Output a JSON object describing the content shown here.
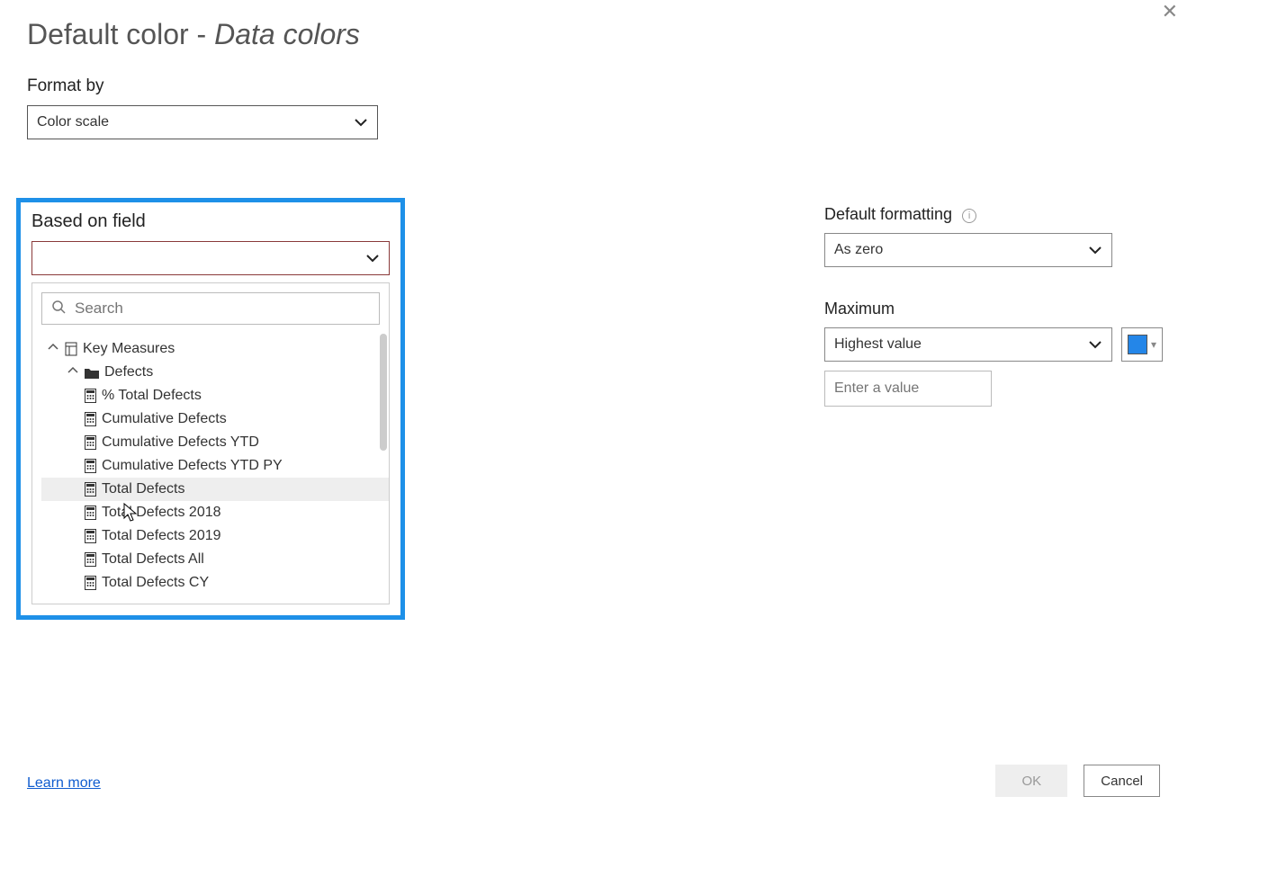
{
  "dialog": {
    "title_main": "Default color",
    "title_sep": " - ",
    "title_italic": "Data colors"
  },
  "format_by": {
    "label": "Format by",
    "value": "Color scale"
  },
  "based_on_field": {
    "label": "Based on field",
    "value": "",
    "search_placeholder": "Search",
    "tree": {
      "group": "Key Measures",
      "folder": "Defects",
      "items": [
        "% Total Defects",
        "Cumulative Defects",
        "Cumulative Defects YTD",
        "Cumulative Defects YTD PY",
        "Total Defects",
        "Total Defects 2018",
        "Total Defects 2019",
        "Total Defects All",
        "Total Defects CY"
      ],
      "hover_index": 4
    }
  },
  "default_formatting": {
    "label": "Default formatting",
    "value": "As zero"
  },
  "maximum": {
    "label": "Maximum",
    "value": "Highest value",
    "color": "#2486e8",
    "input_placeholder": "Enter a value"
  },
  "footer": {
    "learn_more": "Learn more",
    "ok": "OK",
    "cancel": "Cancel"
  }
}
